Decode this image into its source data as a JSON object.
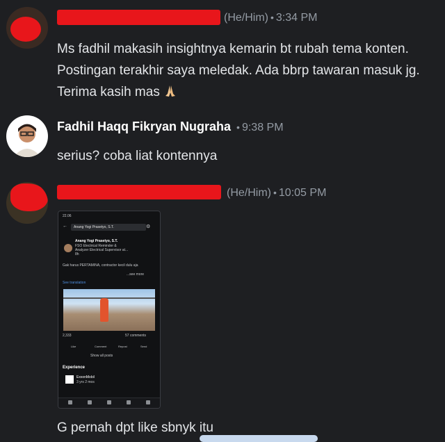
{
  "messages": [
    {
      "pronouns": "(He/Him)",
      "time": "3:34 PM",
      "text": "Ms fadhil makasih insightnya kemarin bt rubah tema konten. Postingan terakhir saya meledak. Ada bbrp tawaran masuk jg. Terima kasih mas"
    },
    {
      "author": "Fadhil Haqq Fikryan Nugraha",
      "time": "9:38 PM",
      "text": "serius? coba liat kontennya"
    },
    {
      "pronouns": "(He/Him)",
      "time": "10:05 PM",
      "text": "G pernah dpt like sbnyk itu"
    }
  ],
  "attachment": {
    "status_time": "22.06",
    "search_text": "Anang Yogi Prasetyo, S.T.",
    "profile_name": "Anang Yogi Prasetyo, S.T.",
    "headline_1": "FSO Electrical Reminder &",
    "headline_2": "Analyzer Electrical Supervisor at...",
    "headline_3": "8h",
    "post_text": "Gak harus PERTAMINA, contractor kecil dulu aja",
    "see_more": "...see more",
    "see_translation": "See translation",
    "reactions": "2,333",
    "comments": "57 comments",
    "actions": [
      "Like",
      "Comment",
      "Repost",
      "Send"
    ],
    "show_all": "Show all posts",
    "experience": "Experience",
    "company": "ExxonMobil",
    "duration": "3 yrs 2 mos",
    "nav": [
      "Home",
      "My Network",
      "Post",
      "Notifications",
      "Jobs"
    ]
  },
  "colors": {
    "background": "#1e1f22",
    "redaction": "#e8161b",
    "link": "#4f8fe0"
  }
}
